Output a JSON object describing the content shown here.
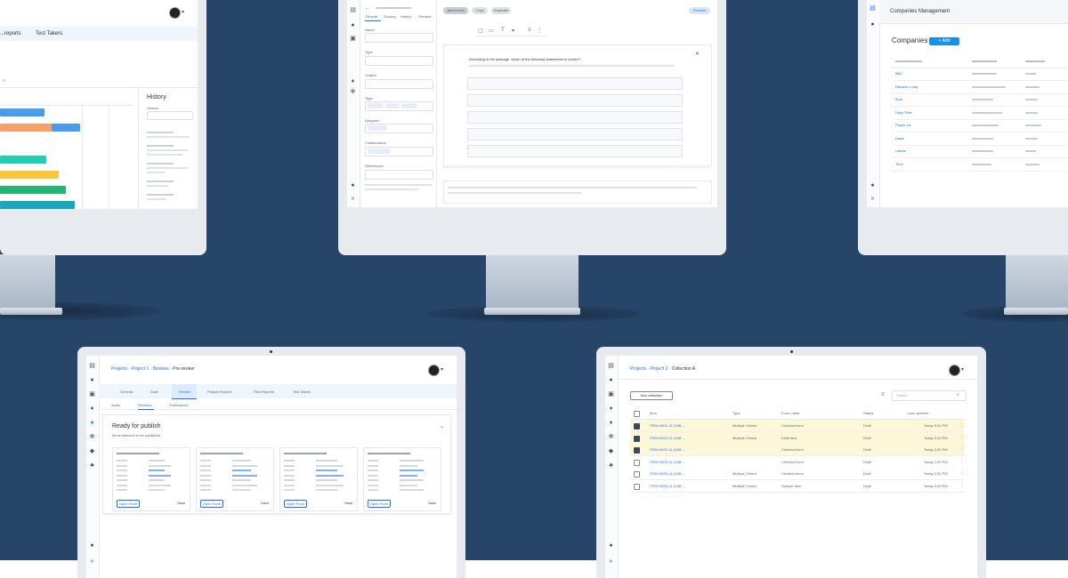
{
  "colors": {
    "background": "#274569",
    "accent": "#1a8fe3",
    "bar_blue": "#4a9af0",
    "bar_orange": "#f6a06a",
    "bar_teal": "#1ecfb1",
    "bar_yellow": "#f7c73b",
    "bar_green": "#22b573",
    "selected_row": "#fdf7da"
  },
  "monitor1": {
    "tab_1": "...reports",
    "tab_2": "Test Takers",
    "history_title": "History",
    "history_field_label": "Version"
  },
  "monitor2": {
    "tabs": [
      "General",
      "Scoring",
      "History",
      "Preview"
    ],
    "field_labels": [
      "Name",
      "Type",
      "Subject",
      "Tags",
      "Assignee",
      "Collaborators",
      "References"
    ],
    "question_text": "According to the passage, which of the following statements is correct?",
    "pills": [
      "Add to test",
      "Copy",
      "Duplicate"
    ],
    "preview_button": "Preview"
  },
  "monitor3": {
    "header_title": "Companies Management",
    "page_title": "Companies",
    "add_button": "+ Add company",
    "companies": [
      "BBC",
      "Reuters Lucky",
      "Bold",
      "Daily Tribe",
      "Peace Inc",
      "Dawn",
      "Labels",
      "Time"
    ]
  },
  "monitor4": {
    "breadcrumb": [
      "Projects",
      "Project 1",
      "Binaries",
      "Pre-review"
    ],
    "tabs": [
      "General",
      "Draft",
      "Review",
      "Project Reports",
      "Pilot Reports",
      "Test Takers"
    ],
    "subtabs": [
      "Audio",
      "Sections",
      "Publications"
    ],
    "section_title": "Ready for publish",
    "section_subtitle": "Items selected to be published",
    "card_button": "Open Form",
    "card_link": "Save"
  },
  "monitor5": {
    "breadcrumb": [
      "Projects",
      "Project 2",
      "Collection A"
    ],
    "action_button": "Add collection",
    "search_placeholder": "Search",
    "columns": [
      "Item",
      "Type",
      "Form Label",
      "Status",
      "Last updated"
    ],
    "rows": [
      {
        "item": "ITEM-0001-11-1158-...",
        "type": "Multiple Choice",
        "label": "Checked form",
        "status": "Draft",
        "date": "Today 3:30 PM",
        "checked": true
      },
      {
        "item": "ITEM-0002-11-1158-...",
        "type": "Multiple Choice",
        "label": "Draft item",
        "status": "Draft",
        "date": "Today 3:30 PM",
        "checked": true
      },
      {
        "item": "ITEM-0003-11-1158-...",
        "type": "",
        "label": "Checked form",
        "status": "Draft",
        "date": "Today 3:30 PM",
        "checked": true
      },
      {
        "item": "ITEM-0004-11-1158-...",
        "type": "",
        "label": "Checked form",
        "status": "Draft",
        "date": "Today 3:30 PM",
        "checked": false
      },
      {
        "item": "ITEM-0005-11-1158-...",
        "type": "Multiple Choice",
        "label": "Checked form",
        "status": "Draft",
        "date": "Today 3:30 PM",
        "checked": false
      },
      {
        "item": "ITEM-0006-11-1158-...",
        "type": "Multiple Choice",
        "label": "Sample item",
        "status": "Draft",
        "date": "Today 3:30 PM",
        "checked": false
      }
    ]
  }
}
